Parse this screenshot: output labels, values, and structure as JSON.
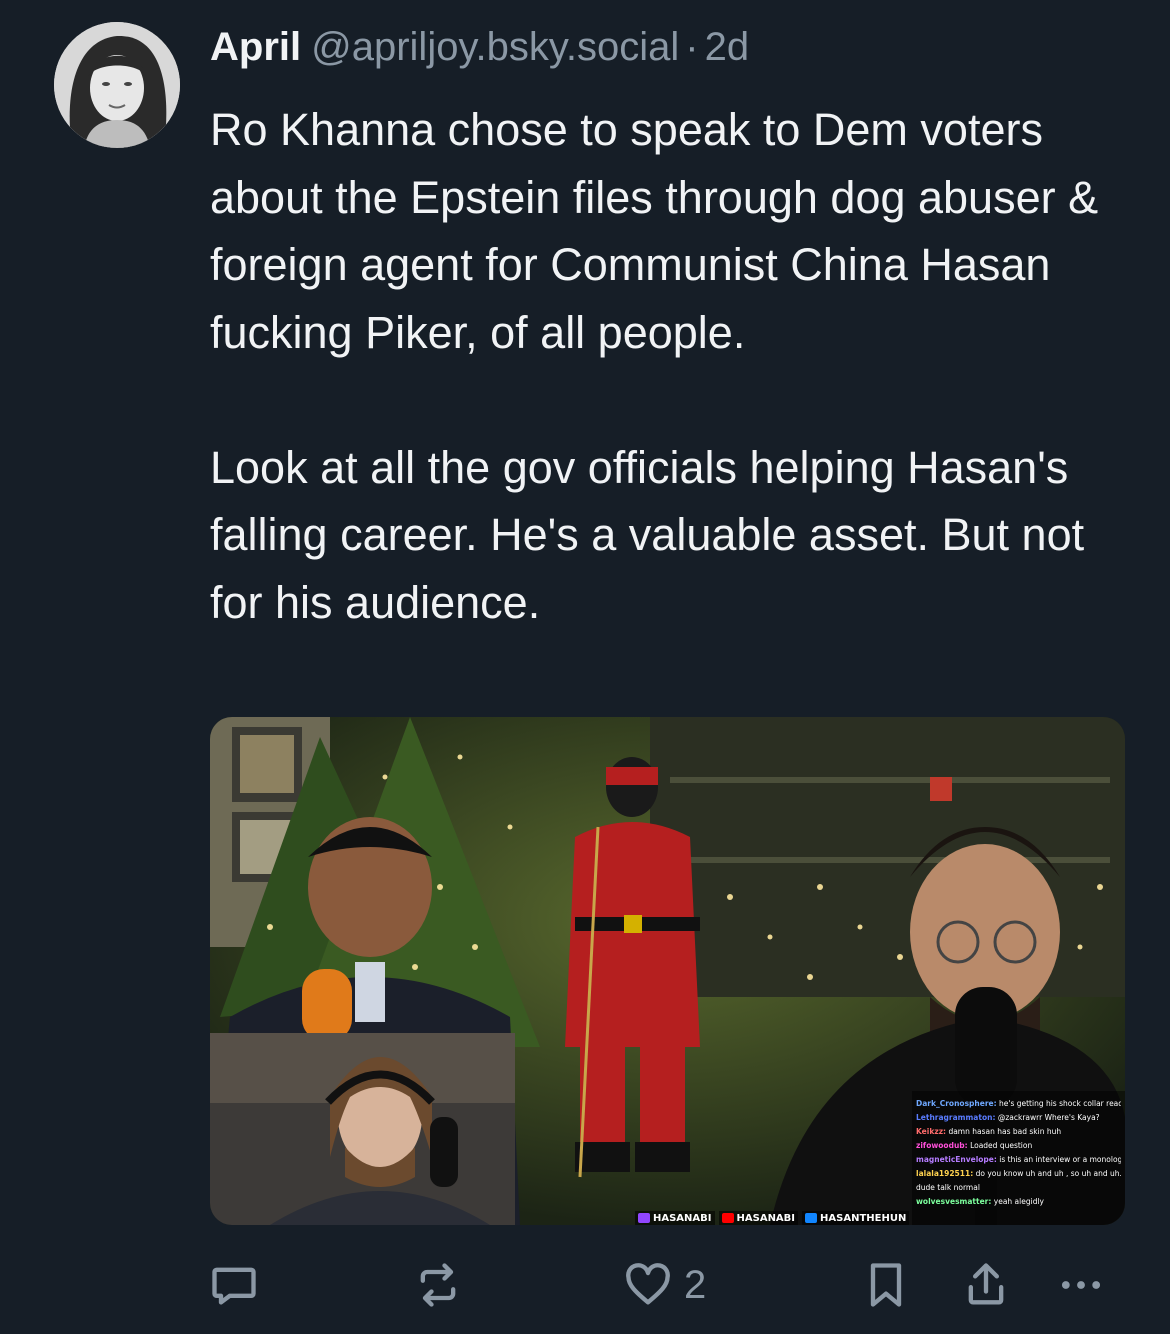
{
  "post": {
    "author": {
      "display_name": "April",
      "handle": "@apriljoy.bsky.social",
      "separator": "·",
      "time": "2d"
    },
    "text": "Ro Khanna chose to speak to Dem voters about the Epstein files through dog abuser & foreign agent for Communist China Hasan fucking Piker, of all people.\n\nLook at all the gov officials helping Hasan's falling career. He's a valuable asset. But not for his audience.",
    "media": {
      "stream_tags": [
        {
          "label": "HASANABI",
          "icon": "twitch-icon",
          "color": "#9146ff"
        },
        {
          "label": "HASANABI",
          "icon": "youtube-icon",
          "color": "#ff0000"
        },
        {
          "label": "HASANTHEHUN",
          "icon": "bluesky-icon",
          "color": "#1185fe"
        }
      ],
      "chat": [
        {
          "user": "Dark_Cronosphere:",
          "user_color": "#6fa8ff",
          "message": "he's getting his shock collar ready"
        },
        {
          "user": "Lethragrammaton:",
          "user_color": "#5a7cff",
          "message": "@zackrawrr Where's Kaya?"
        },
        {
          "user": "Keikzz:",
          "user_color": "#ff6b6b",
          "message": "damn hasan has bad skin huh"
        },
        {
          "user": "zifowoodub:",
          "user_color": "#ff4fd8",
          "message": "Loaded question"
        },
        {
          "user": "magneticEnvelope:",
          "user_color": "#b57cff",
          "message": "is this an interview or a monologue"
        },
        {
          "user": "lalala192511:",
          "user_color": "#ffd24f",
          "message": "do you know uh and uh , so uh and uh."
        },
        {
          "user": "",
          "user_color": "#ffffff",
          "message": "dude talk normal"
        },
        {
          "user": "wolvesvesmatter:",
          "user_color": "#7cff9d",
          "message": "yeah alegidly"
        }
      ]
    },
    "actions": {
      "reply_icon": "reply-icon",
      "repost_icon": "repost-icon",
      "like_icon": "heart-icon",
      "like_count": "2",
      "bookmark_icon": "bookmark-icon",
      "share_icon": "share-icon",
      "more_icon": "more-icon"
    },
    "colors": {
      "background": "#161e27",
      "text": "#f1f3f5",
      "muted": "#8b98a5"
    }
  }
}
